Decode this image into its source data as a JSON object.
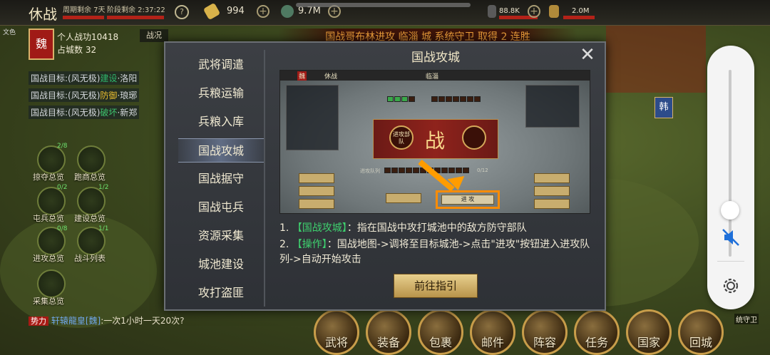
{
  "topbar": {
    "mode": "休战",
    "cycle_remaining": "周期剩余 7天",
    "stage_remaining": "阶段剩余 2:37:22",
    "help": "?",
    "gold": "994",
    "jade": "9.7M",
    "troops": "88.8K",
    "food": "2.0M"
  },
  "banner": {
    "prefix": "国战",
    "actor": "哥布林",
    "action": "进攻 临淄 城 系统守卫 取得 2 连胜"
  },
  "player": {
    "faction": "魏",
    "power_label": "个人战功",
    "power_value": "10418",
    "cities_label": "占城数",
    "cities_value": "32",
    "war_state": "战况",
    "faction_short": "文色"
  },
  "goals": [
    {
      "prefix": "国战目标:(风无极)",
      "kind": "建设",
      "target": "·洛阳"
    },
    {
      "prefix": "国战目标:(风无极)",
      "kind": "防御",
      "target": "·琅琊"
    },
    {
      "prefix": "国战目标:(风无极)",
      "kind": "破坏",
      "target": "·新郑"
    }
  ],
  "quick": [
    {
      "label": "掠夺总览",
      "badge": "2/8"
    },
    {
      "label": "跑商总览",
      "badge": ""
    },
    {
      "label": "屯兵总览",
      "badge": "0/2"
    },
    {
      "label": "建设总览",
      "badge": "1/2"
    },
    {
      "label": "进攻总览",
      "badge": "0/8"
    },
    {
      "label": "战斗列表",
      "badge": "1/1"
    },
    {
      "label": "采集总览",
      "badge": ""
    }
  ],
  "chat": {
    "tag": "势力",
    "name": "轩辕龍皇[魏]",
    "text": ":一次1小时一天20次?"
  },
  "bottom_nav": [
    "武将",
    "装备",
    "包裹",
    "邮件",
    "阵容",
    "任务",
    "国家",
    "回城"
  ],
  "map": {
    "han": "韩",
    "guard": "统守卫"
  },
  "modal": {
    "title": "国战攻城",
    "close": "✕",
    "sidebar": [
      "武将调遣",
      "兵粮运输",
      "兵粮入库",
      "国战攻城",
      "国战据守",
      "国战屯兵",
      "资源采集",
      "城池建设",
      "攻打盗匪"
    ],
    "active_index": 3,
    "preview": {
      "faction": "魏",
      "state": "休战",
      "city": "临淄",
      "zhan": "战",
      "attack_team": "进攻部队",
      "attack_btn": "进 攻",
      "queue_label": "进攻队列",
      "queue_count": "0/12"
    },
    "desc": [
      {
        "num": "1.",
        "kw": "【国战攻城】",
        "text": "：指在国战中攻打城池中的敌方防守部队"
      },
      {
        "num": "2.",
        "kw": "【操作】",
        "text": "：国战地图->调将至目标城池->点击\"进攻\"按钮进入进攻队列->自动开始攻击"
      }
    ],
    "goto_button": "前往指引"
  },
  "volume": {
    "level": 0.29,
    "muted": true
  },
  "colors": {
    "accent_gold": "#d8b26a",
    "highlight_orange": "#ff8c00",
    "keyword_green": "#3ed06e",
    "banner_orange": "#f2a23b"
  }
}
